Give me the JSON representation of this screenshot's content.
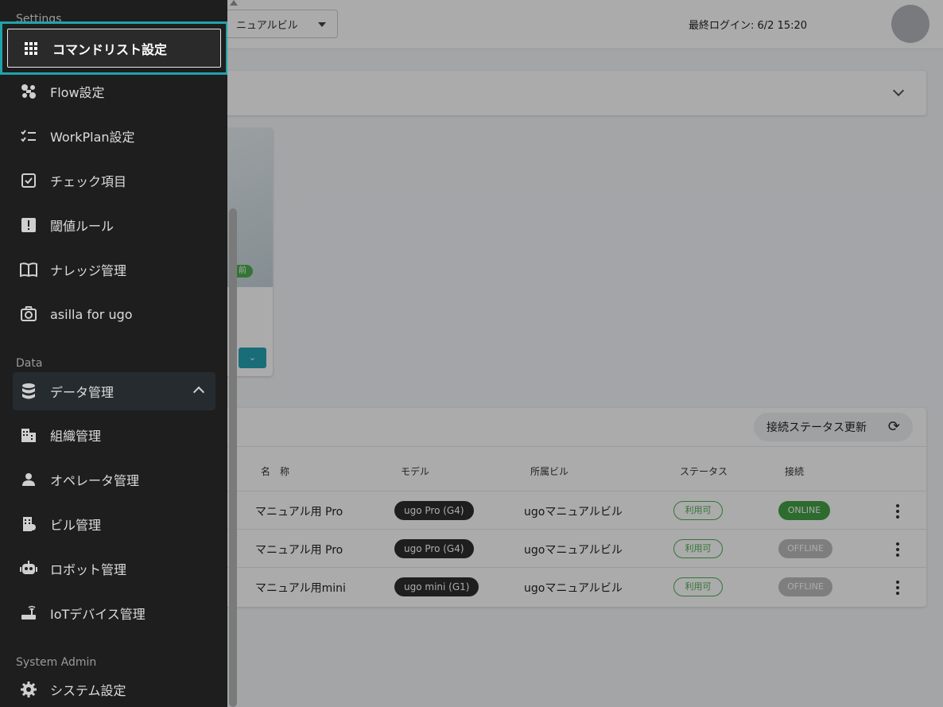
{
  "topbar": {
    "building_select_value": "ニュアルビル",
    "last_login": "最終ログイン: 6/2 15:20"
  },
  "robot_card": {
    "time_badge": "前"
  },
  "robots_panel": {
    "refresh_label": "接続ステータス更新",
    "columns": [
      "名　称",
      "モデル",
      "所属ビル",
      "ステータス",
      "接続"
    ],
    "rows": [
      {
        "name": "マニュアル用 Pro",
        "model": "ugo Pro (G4)",
        "building": "ugoマニュアルビル",
        "status": "利用可",
        "connection": "ONLINE"
      },
      {
        "name": "マニュアル用 Pro",
        "model": "ugo Pro (G4)",
        "building": "ugoマニュアルビル",
        "status": "利用可",
        "connection": "OFFLINE"
      },
      {
        "name": "マニュアル用mini",
        "model": "ugo mini (G1)",
        "building": "ugoマニュアルビル",
        "status": "利用可",
        "connection": "OFFLINE"
      }
    ]
  },
  "colors": {
    "drawer_bg": "#1e1e1e",
    "highlight": "#20a3a8",
    "online": "#43a047",
    "offline": "#bdbdbd",
    "status": "#4caf50"
  },
  "drawer": {
    "sections": {
      "settings": "Settings",
      "data": "Data",
      "system_admin": "System Admin"
    },
    "items": [
      {
        "label": "コマンドリスト設定",
        "icon": "grid-icon"
      },
      {
        "label": "Flow設定",
        "icon": "flow-icon"
      },
      {
        "label": "WorkPlan設定",
        "icon": "checklist-icon"
      },
      {
        "label": "チェック項目",
        "icon": "check-box-icon"
      },
      {
        "label": "閾値ルール",
        "icon": "alert-icon"
      },
      {
        "label": "ナレッジ管理",
        "icon": "book-icon"
      },
      {
        "label": "asilla for ugo",
        "icon": "camera-icon"
      },
      {
        "label": "データ管理",
        "icon": "database-icon"
      },
      {
        "label": "組織管理",
        "icon": "organization-icon"
      },
      {
        "label": "オペレータ管理",
        "icon": "person-icon"
      },
      {
        "label": "ビル管理",
        "icon": "building-icon"
      },
      {
        "label": "ロボット管理",
        "icon": "robot-icon"
      },
      {
        "label": "IoTデバイス管理",
        "icon": "router-icon"
      },
      {
        "label": "システム設定",
        "icon": "gear-icon"
      }
    ]
  }
}
